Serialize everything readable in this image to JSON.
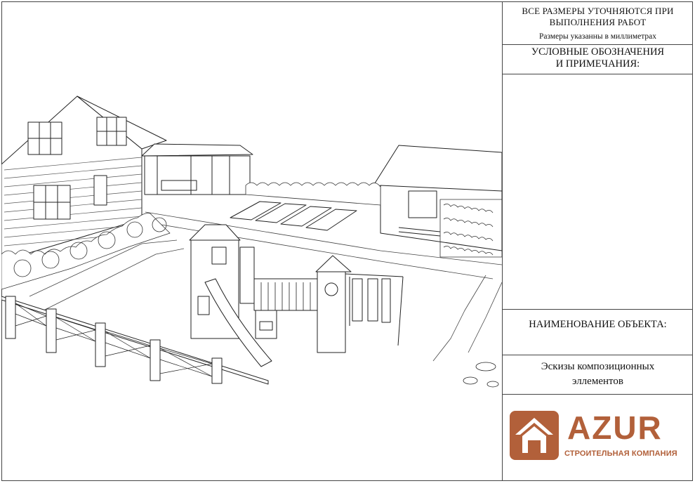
{
  "title_block": {
    "note_line1": "ВСЕ РАЗМЕРЫ УТОЧНЯЮТСЯ ПРИ",
    "note_line2": "ВЫПОЛНЕНИЯ РАБОТ",
    "units_note": "Размеры указанны в миллиметрах",
    "legend_line1": "УСЛОВНЫЕ ОБОЗНАЧЕНИЯ",
    "legend_line2": "И ПРИМЕЧАНИЯ:",
    "object_label": "НАИМЕНОВАНИЕ ОБЪЕКТА:",
    "object_line1": "Эскизы композиционных",
    "object_line2": "эллементов"
  },
  "logo": {
    "brand": "AZUR",
    "tagline": "СТРОИТЕЛЬНАЯ КОМПАНИЯ",
    "brand_color": "#b2603a",
    "icon": "house-icon"
  }
}
